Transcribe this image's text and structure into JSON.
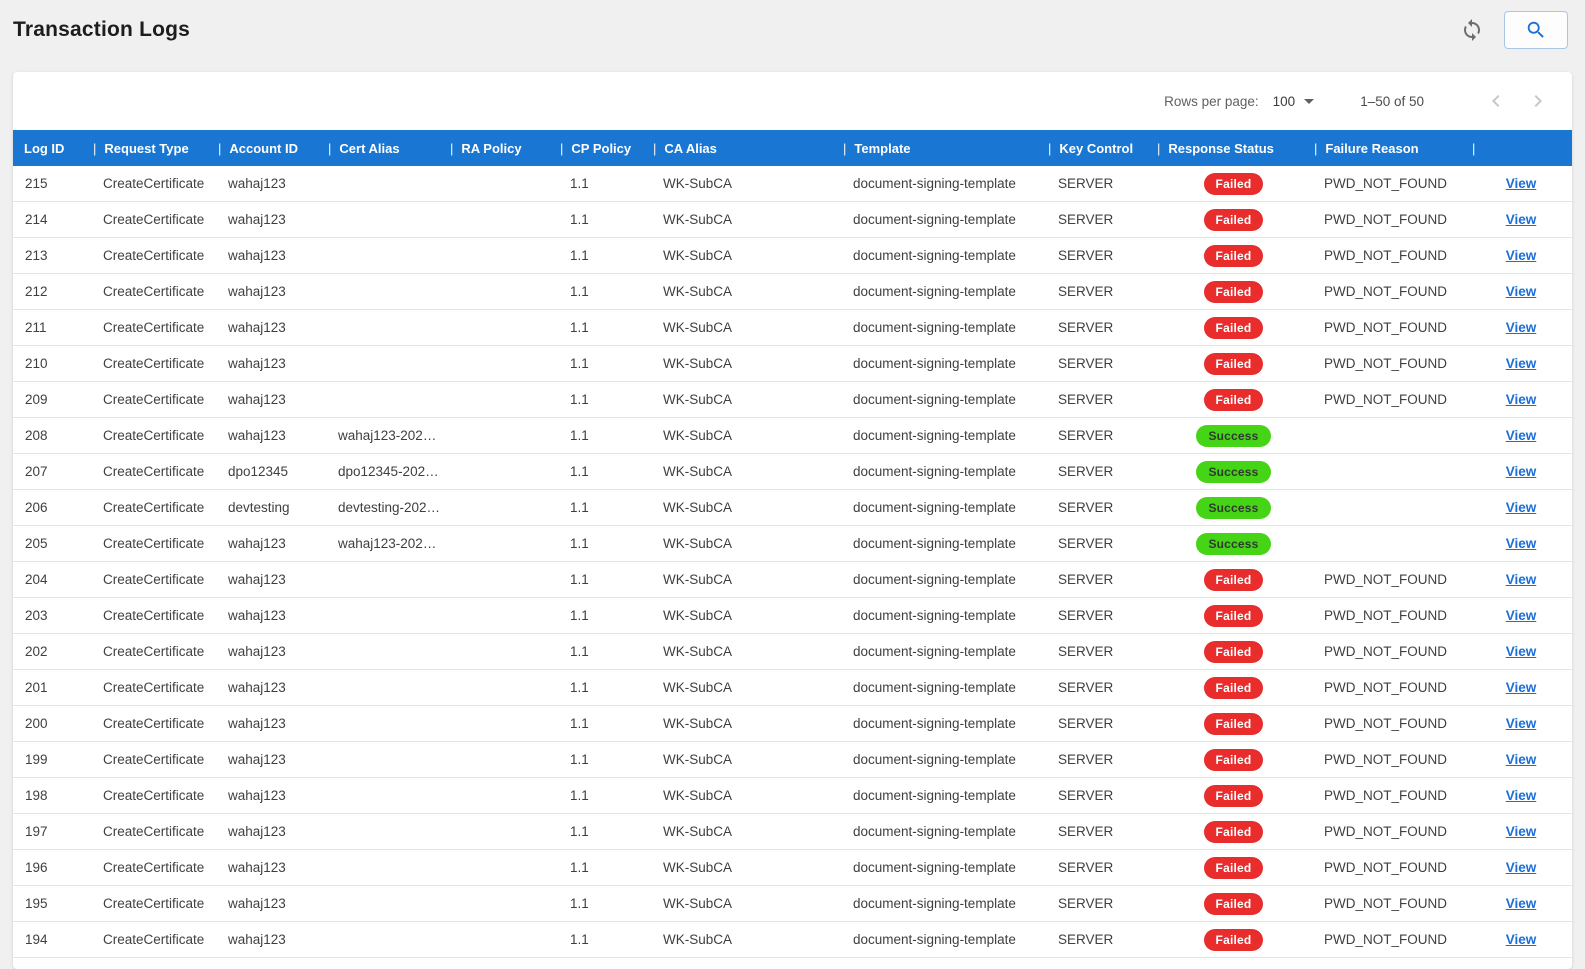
{
  "colors": {
    "header_blue": "#1976d2",
    "failed_red": "#e92c2c",
    "success_green": "#46d416",
    "link_blue": "#1a6fd4",
    "page_bg": "#f0f0f0"
  },
  "header": {
    "title": "Transaction Logs",
    "refresh_icon": "refresh-icon",
    "search_icon": "search-icon"
  },
  "pagination": {
    "rows_per_page_label": "Rows per page:",
    "rows_per_page_value": "100",
    "range_label": "1–50 of 50",
    "prev_icon": "chevron-left-icon",
    "next_icon": "chevron-right-icon"
  },
  "table": {
    "columns": [
      {
        "key": "log_id",
        "label": "Log ID"
      },
      {
        "key": "request_type",
        "label": "Request Type"
      },
      {
        "key": "account_id",
        "label": "Account ID"
      },
      {
        "key": "cert_alias",
        "label": "Cert Alias"
      },
      {
        "key": "ra_policy",
        "label": "RA Policy"
      },
      {
        "key": "cp_policy",
        "label": "CP Policy"
      },
      {
        "key": "ca_alias",
        "label": "CA Alias"
      },
      {
        "key": "template",
        "label": "Template"
      },
      {
        "key": "key_control",
        "label": "Key Control"
      },
      {
        "key": "response_status",
        "label": "Response Status"
      },
      {
        "key": "failure_reason",
        "label": "Failure Reason"
      },
      {
        "key": "view",
        "label": ""
      }
    ],
    "rows": [
      {
        "log_id": "215",
        "request_type": "CreateCertificate",
        "account_id": "wahaj123",
        "cert_alias": "",
        "ra_policy": "",
        "cp_policy": "1.1",
        "ca_alias": "WK-SubCA",
        "template": "document-signing-template",
        "key_control": "SERVER",
        "response_status": "Failed",
        "failure_reason": "PWD_NOT_FOUND",
        "view": "View"
      },
      {
        "log_id": "214",
        "request_type": "CreateCertificate",
        "account_id": "wahaj123",
        "cert_alias": "",
        "ra_policy": "",
        "cp_policy": "1.1",
        "ca_alias": "WK-SubCA",
        "template": "document-signing-template",
        "key_control": "SERVER",
        "response_status": "Failed",
        "failure_reason": "PWD_NOT_FOUND",
        "view": "View"
      },
      {
        "log_id": "213",
        "request_type": "CreateCertificate",
        "account_id": "wahaj123",
        "cert_alias": "",
        "ra_policy": "",
        "cp_policy": "1.1",
        "ca_alias": "WK-SubCA",
        "template": "document-signing-template",
        "key_control": "SERVER",
        "response_status": "Failed",
        "failure_reason": "PWD_NOT_FOUND",
        "view": "View"
      },
      {
        "log_id": "212",
        "request_type": "CreateCertificate",
        "account_id": "wahaj123",
        "cert_alias": "",
        "ra_policy": "",
        "cp_policy": "1.1",
        "ca_alias": "WK-SubCA",
        "template": "document-signing-template",
        "key_control": "SERVER",
        "response_status": "Failed",
        "failure_reason": "PWD_NOT_FOUND",
        "view": "View"
      },
      {
        "log_id": "211",
        "request_type": "CreateCertificate",
        "account_id": "wahaj123",
        "cert_alias": "",
        "ra_policy": "",
        "cp_policy": "1.1",
        "ca_alias": "WK-SubCA",
        "template": "document-signing-template",
        "key_control": "SERVER",
        "response_status": "Failed",
        "failure_reason": "PWD_NOT_FOUND",
        "view": "View"
      },
      {
        "log_id": "210",
        "request_type": "CreateCertificate",
        "account_id": "wahaj123",
        "cert_alias": "",
        "ra_policy": "",
        "cp_policy": "1.1",
        "ca_alias": "WK-SubCA",
        "template": "document-signing-template",
        "key_control": "SERVER",
        "response_status": "Failed",
        "failure_reason": "PWD_NOT_FOUND",
        "view": "View"
      },
      {
        "log_id": "209",
        "request_type": "CreateCertificate",
        "account_id": "wahaj123",
        "cert_alias": "",
        "ra_policy": "",
        "cp_policy": "1.1",
        "ca_alias": "WK-SubCA",
        "template": "document-signing-template",
        "key_control": "SERVER",
        "response_status": "Failed",
        "failure_reason": "PWD_NOT_FOUND",
        "view": "View"
      },
      {
        "log_id": "208",
        "request_type": "CreateCertificate",
        "account_id": "wahaj123",
        "cert_alias": "wahaj123-202…",
        "ra_policy": "",
        "cp_policy": "1.1",
        "ca_alias": "WK-SubCA",
        "template": "document-signing-template",
        "key_control": "SERVER",
        "response_status": "Success",
        "failure_reason": "",
        "view": "View"
      },
      {
        "log_id": "207",
        "request_type": "CreateCertificate",
        "account_id": "dpo12345",
        "cert_alias": "dpo12345-202…",
        "ra_policy": "",
        "cp_policy": "1.1",
        "ca_alias": "WK-SubCA",
        "template": "document-signing-template",
        "key_control": "SERVER",
        "response_status": "Success",
        "failure_reason": "",
        "view": "View"
      },
      {
        "log_id": "206",
        "request_type": "CreateCertificate",
        "account_id": "devtesting",
        "cert_alias": "devtesting-202…",
        "ra_policy": "",
        "cp_policy": "1.1",
        "ca_alias": "WK-SubCA",
        "template": "document-signing-template",
        "key_control": "SERVER",
        "response_status": "Success",
        "failure_reason": "",
        "view": "View"
      },
      {
        "log_id": "205",
        "request_type": "CreateCertificate",
        "account_id": "wahaj123",
        "cert_alias": "wahaj123-202…",
        "ra_policy": "",
        "cp_policy": "1.1",
        "ca_alias": "WK-SubCA",
        "template": "document-signing-template",
        "key_control": "SERVER",
        "response_status": "Success",
        "failure_reason": "",
        "view": "View"
      },
      {
        "log_id": "204",
        "request_type": "CreateCertificate",
        "account_id": "wahaj123",
        "cert_alias": "",
        "ra_policy": "",
        "cp_policy": "1.1",
        "ca_alias": "WK-SubCA",
        "template": "document-signing-template",
        "key_control": "SERVER",
        "response_status": "Failed",
        "failure_reason": "PWD_NOT_FOUND",
        "view": "View"
      },
      {
        "log_id": "203",
        "request_type": "CreateCertificate",
        "account_id": "wahaj123",
        "cert_alias": "",
        "ra_policy": "",
        "cp_policy": "1.1",
        "ca_alias": "WK-SubCA",
        "template": "document-signing-template",
        "key_control": "SERVER",
        "response_status": "Failed",
        "failure_reason": "PWD_NOT_FOUND",
        "view": "View"
      },
      {
        "log_id": "202",
        "request_type": "CreateCertificate",
        "account_id": "wahaj123",
        "cert_alias": "",
        "ra_policy": "",
        "cp_policy": "1.1",
        "ca_alias": "WK-SubCA",
        "template": "document-signing-template",
        "key_control": "SERVER",
        "response_status": "Failed",
        "failure_reason": "PWD_NOT_FOUND",
        "view": "View"
      },
      {
        "log_id": "201",
        "request_type": "CreateCertificate",
        "account_id": "wahaj123",
        "cert_alias": "",
        "ra_policy": "",
        "cp_policy": "1.1",
        "ca_alias": "WK-SubCA",
        "template": "document-signing-template",
        "key_control": "SERVER",
        "response_status": "Failed",
        "failure_reason": "PWD_NOT_FOUND",
        "view": "View"
      },
      {
        "log_id": "200",
        "request_type": "CreateCertificate",
        "account_id": "wahaj123",
        "cert_alias": "",
        "ra_policy": "",
        "cp_policy": "1.1",
        "ca_alias": "WK-SubCA",
        "template": "document-signing-template",
        "key_control": "SERVER",
        "response_status": "Failed",
        "failure_reason": "PWD_NOT_FOUND",
        "view": "View"
      },
      {
        "log_id": "199",
        "request_type": "CreateCertificate",
        "account_id": "wahaj123",
        "cert_alias": "",
        "ra_policy": "",
        "cp_policy": "1.1",
        "ca_alias": "WK-SubCA",
        "template": "document-signing-template",
        "key_control": "SERVER",
        "response_status": "Failed",
        "failure_reason": "PWD_NOT_FOUND",
        "view": "View"
      },
      {
        "log_id": "198",
        "request_type": "CreateCertificate",
        "account_id": "wahaj123",
        "cert_alias": "",
        "ra_policy": "",
        "cp_policy": "1.1",
        "ca_alias": "WK-SubCA",
        "template": "document-signing-template",
        "key_control": "SERVER",
        "response_status": "Failed",
        "failure_reason": "PWD_NOT_FOUND",
        "view": "View"
      },
      {
        "log_id": "197",
        "request_type": "CreateCertificate",
        "account_id": "wahaj123",
        "cert_alias": "",
        "ra_policy": "",
        "cp_policy": "1.1",
        "ca_alias": "WK-SubCA",
        "template": "document-signing-template",
        "key_control": "SERVER",
        "response_status": "Failed",
        "failure_reason": "PWD_NOT_FOUND",
        "view": "View"
      },
      {
        "log_id": "196",
        "request_type": "CreateCertificate",
        "account_id": "wahaj123",
        "cert_alias": "",
        "ra_policy": "",
        "cp_policy": "1.1",
        "ca_alias": "WK-SubCA",
        "template": "document-signing-template",
        "key_control": "SERVER",
        "response_status": "Failed",
        "failure_reason": "PWD_NOT_FOUND",
        "view": "View"
      },
      {
        "log_id": "195",
        "request_type": "CreateCertificate",
        "account_id": "wahaj123",
        "cert_alias": "",
        "ra_policy": "",
        "cp_policy": "1.1",
        "ca_alias": "WK-SubCA",
        "template": "document-signing-template",
        "key_control": "SERVER",
        "response_status": "Failed",
        "failure_reason": "PWD_NOT_FOUND",
        "view": "View"
      },
      {
        "log_id": "194",
        "request_type": "CreateCertificate",
        "account_id": "wahaj123",
        "cert_alias": "",
        "ra_policy": "",
        "cp_policy": "1.1",
        "ca_alias": "WK-SubCA",
        "template": "document-signing-template",
        "key_control": "SERVER",
        "response_status": "Failed",
        "failure_reason": "PWD_NOT_FOUND",
        "view": "View"
      }
    ]
  }
}
